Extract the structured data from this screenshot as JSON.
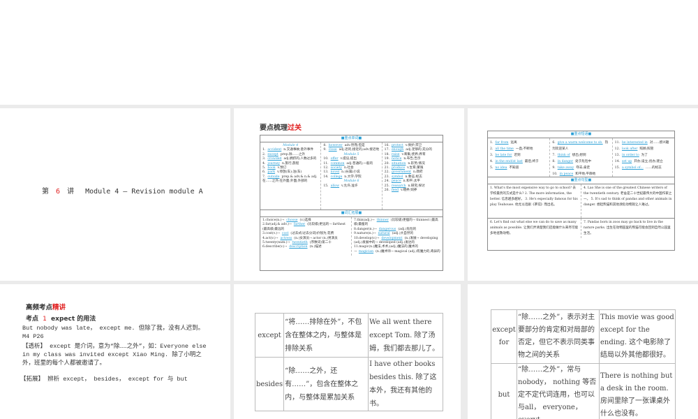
{
  "slide1": {
    "prefix": "第",
    "num": "6",
    "suffix": "讲",
    "title": "Module 4 — Revision module A"
  },
  "slide2": {
    "title_black": "要点梳理",
    "title_red": "过关",
    "sec1": "■重点单词■",
    "col1_head": "Module 4",
    "col1": [
      {
        "n": "1.",
        "a": "accident",
        "t": "n.交通事故;意外事件"
      },
      {
        "n": "2.",
        "a": "except",
        "t": "prep.除……之外"
      },
      {
        "n": "3.",
        "a": "crowded",
        "t": "adj.拥挤的;人数过多的"
      },
      {
        "n": "4.",
        "a": "journey",
        "t": "n.旅行;旅程"
      },
      {
        "n": "5.",
        "a": "book",
        "t": "v.预订"
      },
      {
        "n": "6.",
        "a": "park",
        "t": "v.停放(车);泊(车)"
      },
      {
        "n": "7.",
        "a": "outside",
        "t": "prep.& adv.& n.& adj.在……之外;在外面;外面;外部的"
      }
    ],
    "col2a": [
      {
        "n": "8.",
        "a": "however",
        "t": "adv.然而;但是"
      },
      {
        "n": "9.",
        "a": "close",
        "t": "adj.近的;接近的;adv.接近地"
      }
    ],
    "col2_head1": "Module 5",
    "col2b": [
      {
        "n": "10.",
        "a": "offer",
        "t": "v.提议;提出"
      },
      {
        "n": "11.",
        "a": "common",
        "t": "adj.普通的;一般的"
      },
      {
        "n": "12.",
        "a": "society",
        "t": "n.社会"
      },
      {
        "n": "13.",
        "a": "novel",
        "t": "n.(长篇)小说"
      },
      {
        "n": "14.",
        "a": "college",
        "t": "n.大学;学院"
      }
    ],
    "col2_head2": "Module 6",
    "col2c": [
      {
        "n": "15.",
        "a": "allow",
        "t": "v.允许;准许"
      }
    ],
    "col3": [
      {
        "n": "16.",
        "a": "protect",
        "t": "v.保护;捍卫"
      },
      {
        "n": "17.",
        "a": "enough",
        "t": "adj.足够的;充分的"
      },
      {
        "n": "18.",
        "a": "raise",
        "t": "v.筹集;抚养;养育"
      },
      {
        "n": "19.",
        "a": "notice",
        "t": "n.布告;告示"
      },
      {
        "n": "20.",
        "a": "situation",
        "t": "n.形势;情况"
      },
      {
        "n": "21.",
        "a": "produce",
        "t": "v.生育;繁殖"
      },
      {
        "n": "22.",
        "a": "government",
        "t": "n.政府"
      },
      {
        "n": "23.",
        "a": "symbol",
        "t": "n.象征;标志"
      },
      {
        "n": "24.",
        "a": "peace",
        "t": "n.和平;太平"
      },
      {
        "n": "25.",
        "a": "research",
        "t": "n.研究;探讨"
      },
      {
        "n": "26.",
        "a": "feed",
        "t": "v.喂养;饲养"
      }
    ],
    "sec2": "■词汇拓展■",
    "ext1": [
      {
        "n": "1.choice(n.)→",
        "a": "choose",
        "t": "(v.)选择"
      },
      {
        "n": "2.far(adj.& adv.)→",
        "a": "farther",
        "t": "(比较级)更远的→ farthest (最高级)最远的"
      },
      {
        "n": "3.cost(v.)→",
        "a": "cost",
        "t": "(过去式/过去分词)价钱为;花费"
      },
      {
        "n": "4.act(v.)→",
        "a": "actress",
        "t": "(n.)女演员→ actor (n.)男演员"
      },
      {
        "n": "5.twenty(num.)→",
        "a": "twentieth",
        "t": "(序数词)第二十"
      },
      {
        "n": "6.describe(v.)→",
        "a": "description",
        "t": "(n.)描述"
      }
    ],
    "ext2": [
      {
        "n": "7.thin(adj.)→",
        "a": "thinner",
        "t": "(比较级)更瘦的→ thinnest (最高级)最瘦的"
      },
      {
        "n": "8.danger(n.)→",
        "a": "dangerous",
        "t": "(adj.)危险的"
      },
      {
        "n": "9.nature(n.)→",
        "a": "natural",
        "t": "(adj.)大自然的"
      },
      {
        "n": "10.develop(v.)→",
        "a": "development",
        "t": "(n.)发展→ developing (adj.)发展中的→ developed (adj.)发达的"
      },
      {
        "n": "11.magic(n.)魔法,术术;(adj.)魔法的,魔术的→",
        "a": "magician",
        "t": "(n.)魔术师→ magical (adj.)有魔力的,奇异的"
      }
    ]
  },
  "slide3": {
    "sec1": "■重点短语■",
    "p1": [
      {
        "n": "1.",
        "a": "far from",
        "t": "远离"
      },
      {
        "n": "2.",
        "a": "all the time",
        "t": "一直;不断地"
      },
      {
        "n": "3.",
        "a": "be late for",
        "t": "迟到"
      },
      {
        "n": "4.",
        "a": "in the end/at last",
        "t": "最后;终于"
      },
      {
        "n": "5.",
        "a": "no idea",
        "t": "不知道"
      }
    ],
    "p2": [
      {
        "n": "6.",
        "a": "give a warm welcome to sb.",
        "t": "热烈欢迎某人"
      },
      {
        "n": "7.",
        "a": "think of",
        "t": "想出;想到"
      },
      {
        "n": "8.",
        "a": "in danger",
        "t": "处于危险中"
      },
      {
        "n": "9.",
        "a": "take away",
        "t": "夺去;拿走"
      },
      {
        "n": "10.",
        "a": "in peace",
        "t": "和平地;平静地"
      }
    ],
    "p3": [
      {
        "n": "11.",
        "a": "be interested in",
        "t": "对……感兴趣"
      },
      {
        "n": "12.",
        "a": "look after",
        "t": "照顾;照管"
      },
      {
        "n": "13.",
        "a": "in order to",
        "t": "为了"
      },
      {
        "n": "14.",
        "a": "set up",
        "t": "开办;设立;创办;建立"
      },
      {
        "n": "15.",
        "a": "a symbol of...",
        "t": "……的标志"
      }
    ],
    "sec2": "■重点句型■",
    "s1": "1. What's the most expensive way to go to school? 去学校最贵的方式是什么? 2. The more information, the better. 信息越多越好。 3. He's especially famous for his play Teahouse. 他尤以话剧《茶馆》而出名。",
    "s2": "4. Lao She is one of the greatest Chinese writers of the twentieth century. 老舍是二十世纪最伟大的中国作家之一。 5. It's sad to think of pandas and other animals in danger. 想起熊猫和其他濒危动物就让人难过。",
    "s3": "6. Let's find out what else we can do to save as many animals as possible. 让我们弄清楚我们还能做什么来尽可能多地拯救动物。",
    "s4": "7. Pandas born in zoos may go back to live in the nature parks. 出生在动物园里的熊猫可能会回到自然公园里生活。"
  },
  "slide4": {
    "h_black": "高频考点",
    "h_red": "精讲",
    "point_label": "考点",
    "point_num": "1",
    "point_title": "expect 的用法",
    "p1": "But nobody was late， except me. 但除了我，没有人迟到。 M4 P26",
    "p2": "【透析】 except 是介词，意为“除……之外”，如：Everyone else in my class was invited except Xiao Ming. 除了小明之外，班里的每个人都被邀请了。",
    "p3": "【拓展】 辨析 except， besides， except for 与 but"
  },
  "slide5": {
    "rows": [
      {
        "word": "except",
        "meaning": "“将……排除在外”，不包含在整体之内，与整体是排除关系",
        "example": "We all went there except Tom. 除了汤姆，我们都去那儿了。"
      },
      {
        "word": "besides",
        "meaning": "“除……之外，还有……”，包含在整体之内，与整体是累加关系",
        "example": "I have other books besides this. 除了这本外，我还有其他的书。"
      }
    ]
  },
  "slide6": {
    "rows": [
      {
        "word": "except for",
        "meaning": "“除……之外”，表示对主要部分的肯定和对局部的否定，但它不表示同类事物之间的关系",
        "example": "This movie was good except for the ending. 这个电影除了结局以外其他都很好。"
      },
      {
        "word": "but",
        "meaning": "“除……之外”，常与nobody， nothing 等否定不定代词连用，也可以与all， everyone， everyt",
        "example": "There is nothing but a desk in the room. 房间里除了一张课桌外什么也没有。"
      }
    ]
  }
}
